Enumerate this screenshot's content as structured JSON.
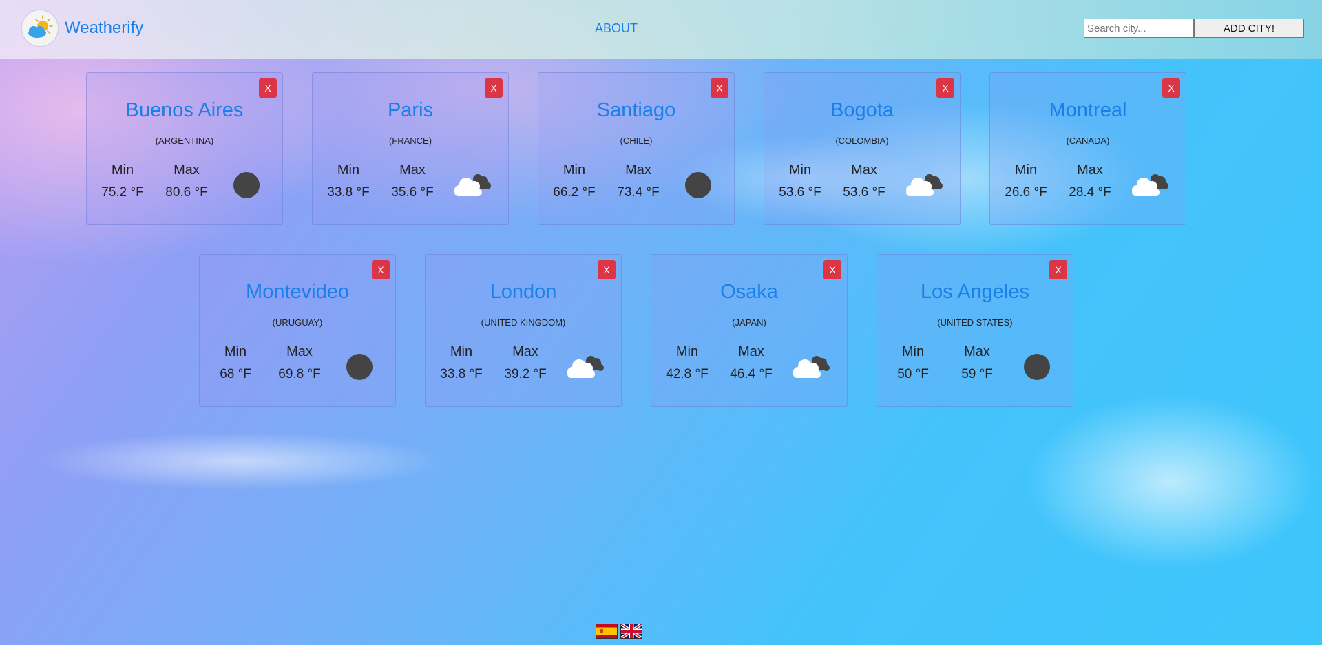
{
  "brand": {
    "name": "Weatherify",
    "logo_icon": "sun-cloud-logo-icon"
  },
  "nav": {
    "about": "ABOUT"
  },
  "search": {
    "placeholder": "Search city...",
    "button": "ADD CITY!"
  },
  "labels": {
    "min": "Min",
    "max": "Max",
    "close": "X"
  },
  "cards": [
    {
      "city": "Buenos Aires",
      "country": "(ARGENTINA)",
      "min": "75.2 °F",
      "max": "80.6 °F",
      "icon": "moon-icon"
    },
    {
      "city": "Paris",
      "country": "(FRANCE)",
      "min": "33.8 °F",
      "max": "35.6 °F",
      "icon": "cloudy-icon"
    },
    {
      "city": "Santiago",
      "country": "(CHILE)",
      "min": "66.2 °F",
      "max": "73.4 °F",
      "icon": "moon-icon"
    },
    {
      "city": "Bogota",
      "country": "(COLOMBIA)",
      "min": "53.6 °F",
      "max": "53.6 °F",
      "icon": "cloudy-icon"
    },
    {
      "city": "Montreal",
      "country": "(CANADA)",
      "min": "26.6 °F",
      "max": "28.4 °F",
      "icon": "cloudy-icon"
    },
    {
      "city": "Montevideo",
      "country": "(URUGUAY)",
      "min": "68 °F",
      "max": "69.8 °F",
      "icon": "moon-icon"
    },
    {
      "city": "London",
      "country": "(UNITED KINGDOM)",
      "min": "33.8 °F",
      "max": "39.2 °F",
      "icon": "cloudy-icon"
    },
    {
      "city": "Osaka",
      "country": "(JAPAN)",
      "min": "42.8 °F",
      "max": "46.4 °F",
      "icon": "cloudy-icon"
    },
    {
      "city": "Los Angeles",
      "country": "(UNITED STATES)",
      "min": "50 °F",
      "max": "59 °F",
      "icon": "moon-icon"
    }
  ],
  "languages": [
    {
      "name": "spanish-flag-icon"
    },
    {
      "name": "uk-flag-icon"
    }
  ],
  "colors": {
    "accent": "#1a7fe8",
    "danger": "#dc3545",
    "moon": "#444444"
  }
}
